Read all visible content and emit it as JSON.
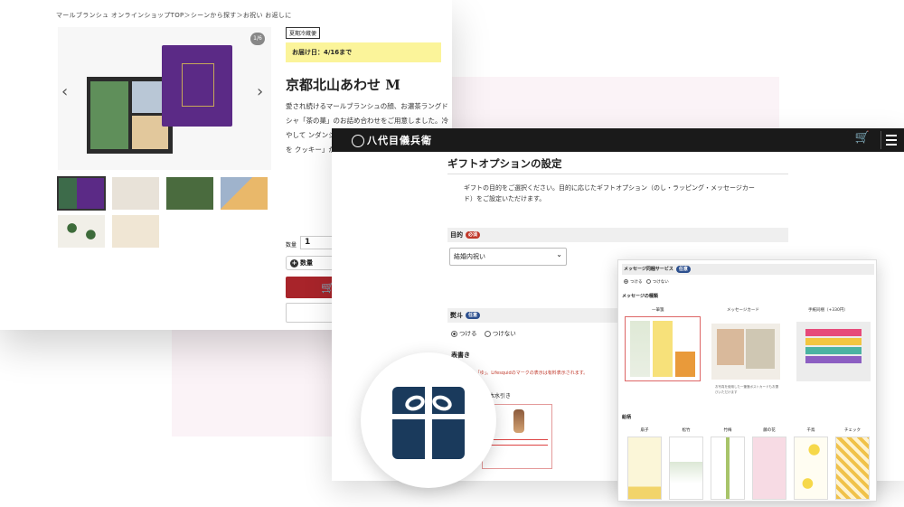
{
  "product_page": {
    "breadcrumb": "マールブランシュ オンラインショップTOP＞シーンから探す＞お祝い お返しに",
    "image_counter": "1/6",
    "badge": "夏期冷蔵便",
    "delivery": "お届け日：4/16まで",
    "title": "京都北山あわせ M",
    "description": "愛され続けるマールブランシュの顔、お濃茶ラングドシャ「茶の菓」のお詰め合わせをご用意しました。冷やして ンダンショコラ 豊かな「ふんわ 香りのバターを クッキー」が揃",
    "quantity_label": "数量",
    "quantity_value": "1",
    "quantity_button": "数量",
    "prev_icon": "chevron-left-icon",
    "next_icon": "chevron-right-icon",
    "cart_icon": "cart-icon"
  },
  "gift_page": {
    "logo": "八代目儀兵衛",
    "cart_icon": "cart-icon",
    "menu_icon": "menu-icon",
    "title": "ギフトオプションの設定",
    "intro": "ギフトの目的をご選択ください。目的に応じたギフトオプション（のし・ラッピング・メッセージカード）をご設定いただけます。",
    "purpose": {
      "label": "目的",
      "badge": "必須",
      "value": "結婚内祝い"
    },
    "noshi": {
      "label": "熨斗",
      "badge": "任意",
      "options": [
        "つける",
        "つけない"
      ],
      "selected": 0
    },
    "omote": {
      "label": "表書き",
      "warning": "※「マーク」「ゆ」。Lifesquidのマークの表示は有料表示されます。",
      "bottom_label": "本水引き"
    }
  },
  "message_card": {
    "header": "メッセージ同梱サービス",
    "header_badge": "任意",
    "options": [
      "つける",
      "つけない"
    ],
    "types_label": "メッセージの種類",
    "types": [
      "一筆箋",
      "メッセージカード",
      "手紙同梱（+330円）"
    ],
    "note": "お写真を使用した一筆箋ポストカードもお選びいただけます",
    "patterns_label": "絵柄",
    "patterns": [
      "扇子",
      "松竹",
      "竹梅",
      "藤の花",
      "千鳥",
      "チェック"
    ]
  },
  "colors": {
    "accent_red": "#a8242a",
    "navy": "#1a3a5c",
    "header_black": "#1a1a1a",
    "yellow": "#fbf49a"
  },
  "icons": {
    "gift": "gift-icon"
  }
}
